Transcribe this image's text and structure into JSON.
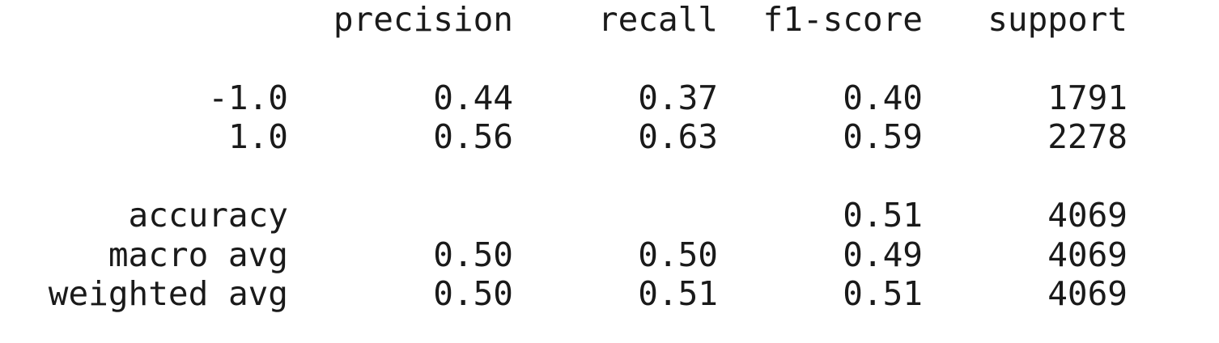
{
  "header": {
    "precision": "precision",
    "recall": "recall",
    "f1_score": "f1-score",
    "support": "support"
  },
  "classes": [
    {
      "label": "-1.0",
      "precision": "0.44",
      "recall": "0.37",
      "f1_score": "0.40",
      "support": "1791"
    },
    {
      "label": "1.0",
      "precision": "0.56",
      "recall": "0.63",
      "f1_score": "0.59",
      "support": "2278"
    }
  ],
  "summary": {
    "accuracy": {
      "label": "accuracy",
      "f1_score": "0.51",
      "support": "4069"
    },
    "macro_avg": {
      "label": "macro avg",
      "precision": "0.50",
      "recall": "0.50",
      "f1_score": "0.49",
      "support": "4069"
    },
    "weighted_avg": {
      "label": "weighted avg",
      "precision": "0.50",
      "recall": "0.51",
      "f1_score": "0.51",
      "support": "4069"
    }
  }
}
